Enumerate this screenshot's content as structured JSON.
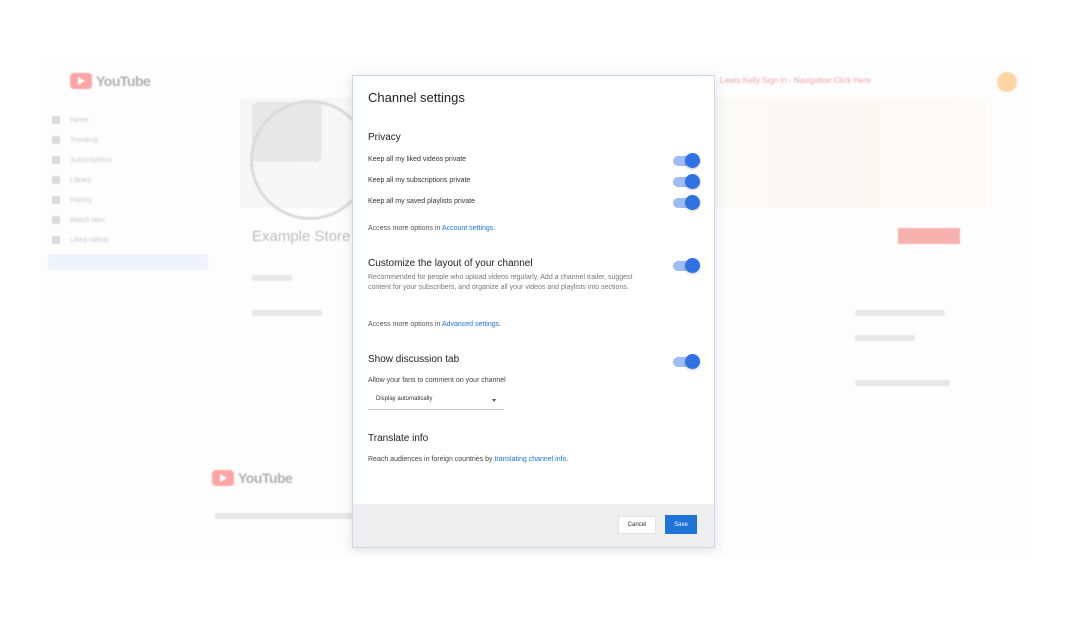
{
  "background": {
    "logo_text": "YouTube",
    "promo_text": "Lewis Kelly Sign in · Navigation Click Here",
    "sidebar_items": [
      "Home",
      "Trending",
      "Subscriptions",
      "Library",
      "History",
      "Watch later",
      "Liked videos"
    ],
    "channel_name": "Example Store",
    "footer_logo_text": "YouTube",
    "colors": {
      "brand_red": "#ff0000",
      "avatar": "#ff8a00"
    }
  },
  "dialog": {
    "title": "Channel settings",
    "privacy": {
      "heading": "Privacy",
      "items": [
        {
          "label": "Keep all my liked videos private",
          "on": true
        },
        {
          "label": "Keep all my subscriptions private",
          "on": true
        },
        {
          "label": "Keep all my saved playlists private",
          "on": true
        }
      ],
      "more_prefix": "Access more options in ",
      "more_link": "Account settings",
      "more_suffix": "."
    },
    "layout": {
      "heading": "Customize the layout of your channel",
      "on": true,
      "description": "Recommended for people who upload videos regularly. Add a channel trailer, suggest content for your subscribers, and organize all your videos and playlists into sections.",
      "more_prefix": "Access more options in ",
      "more_link": "Advanced settings",
      "more_suffix": "."
    },
    "discussion": {
      "heading": "Show discussion tab",
      "on": true,
      "allow_text": "Allow your fans to comment on your channel",
      "select_value": "Display automatically"
    },
    "translate": {
      "heading": "Translate info",
      "text_prefix": "Reach audiences in foreign countries by ",
      "text_link": "translating channel info",
      "text_suffix": "."
    },
    "buttons": {
      "cancel": "Cancel",
      "save": "Save"
    },
    "colors": {
      "accent": "#1e74d6",
      "toggle_knob": "#2f72e6",
      "toggle_track": "#9fbdf2",
      "footer_bg": "#eeeeee"
    }
  }
}
